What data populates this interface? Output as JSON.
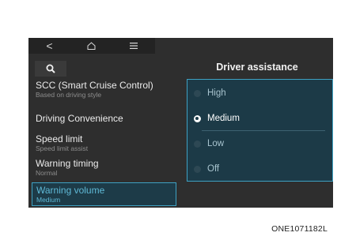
{
  "topbar": {
    "back_glyph": "<",
    "home_icon": "home-icon",
    "menu_icon": "menu-icon"
  },
  "search": {
    "icon": "search-icon"
  },
  "menu_items": [
    {
      "label": "SCC (Smart Cruise Control)",
      "sub": "Based on driving style"
    },
    {
      "label": "Driving Convenience",
      "sub": ""
    },
    {
      "label": "Speed limit",
      "sub": "Speed limit assist"
    },
    {
      "label": "Warning timing",
      "sub": "Normal"
    },
    {
      "label": "Warning volume",
      "sub": "Medium",
      "selected": true
    }
  ],
  "right_panel": {
    "title": "Driver assistance",
    "options": [
      {
        "label": "High",
        "selected": false
      },
      {
        "label": "Medium",
        "selected": true
      },
      {
        "label": "Low",
        "selected": false
      },
      {
        "label": "Off",
        "selected": false
      }
    ]
  },
  "caption": "ONE1071182L",
  "colors": {
    "accent": "#3ea1c2",
    "screen_bg": "#2e2e2e",
    "panel_bg": "#1c3a47"
  }
}
